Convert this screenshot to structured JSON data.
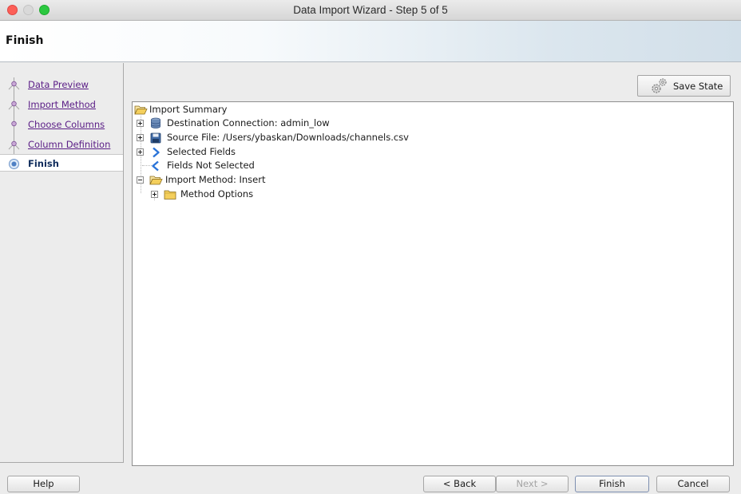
{
  "window": {
    "title": "Data Import Wizard - Step 5 of 5"
  },
  "header": {
    "title": "Finish"
  },
  "nav": {
    "steps": [
      {
        "label": "Data Preview",
        "state": "visited"
      },
      {
        "label": "Import Method",
        "state": "visited"
      },
      {
        "label": "Choose Columns",
        "state": "visited"
      },
      {
        "label": "Column Definition",
        "state": "visited"
      },
      {
        "label": "Finish",
        "state": "current"
      }
    ]
  },
  "toolbar": {
    "save_state_label": "Save State"
  },
  "tree": {
    "root": "Import Summary",
    "items": [
      {
        "label": "Destination Connection: admin_low",
        "icon": "database-icon",
        "expander": "plus"
      },
      {
        "label": "Source File: /Users/ybaskan/Downloads/channels.csv",
        "icon": "floppy-disk-icon",
        "expander": "plus"
      },
      {
        "label": "Selected Fields",
        "icon": "chevron-right-icon",
        "expander": "plus"
      },
      {
        "label": "Fields Not Selected",
        "icon": "chevron-left-icon",
        "expander": "none"
      },
      {
        "label": "Import Method: Insert",
        "icon": "open-folder-icon",
        "expander": "minus"
      }
    ],
    "child": {
      "label": "Method Options",
      "icon": "folder-icon",
      "expander": "plus"
    }
  },
  "footer": {
    "help_label": "Help",
    "back_label": "< Back",
    "next_label": "Next >",
    "finish_label": "Finish",
    "cancel_label": "Cancel"
  },
  "colors": {
    "link_visited": "#5a1d86",
    "current_step": "#0f2c5c",
    "close": "#fc5f57",
    "maximize": "#2bc840"
  }
}
